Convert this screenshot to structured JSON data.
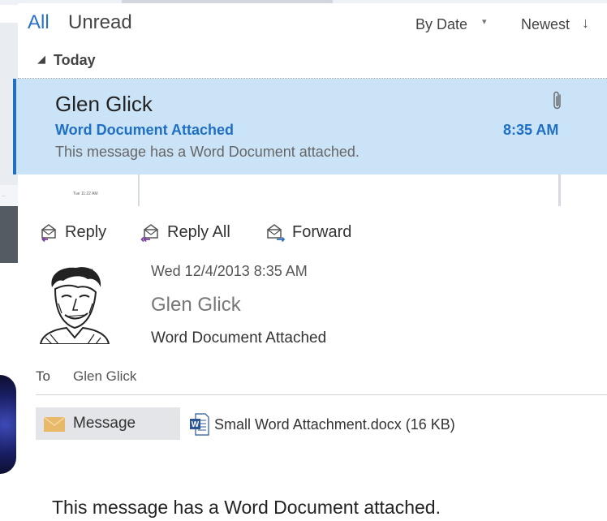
{
  "list": {
    "filters": {
      "all": "All",
      "unread": "Unread"
    },
    "sort": {
      "by": "By Date",
      "by_caret": "▾",
      "order": "Newest",
      "order_arrow": "↓"
    },
    "group": {
      "caret": "◢",
      "label": "Today"
    }
  },
  "selected_message": {
    "sender": "Glen Glick",
    "subject": "Word Document Attached",
    "preview": "This message has a Word Document attached.",
    "time": "8:35 AM",
    "has_attachment": true
  },
  "reading_pane": {
    "actions": {
      "reply": "Reply",
      "reply_all": "Reply All",
      "forward": "Forward"
    },
    "date": "Wed 12/4/2013 8:35 AM",
    "from": "Glen Glick",
    "subject": "Word Document Attached",
    "to_label": "To",
    "to_value": "Glen Glick",
    "message_tab": "Message",
    "attachment": "Small Word Attachment.docx (16 KB)",
    "body": "This message has a Word Document attached."
  },
  "background": {
    "left_tiny": "…",
    "mid_tiny": "Tue 11:22 AM"
  },
  "colors": {
    "accent": "#1f6fc5",
    "selected_bg": "#cbe3f6",
    "tab_bg": "#e3e5e8",
    "envelope": "#e8b968"
  }
}
